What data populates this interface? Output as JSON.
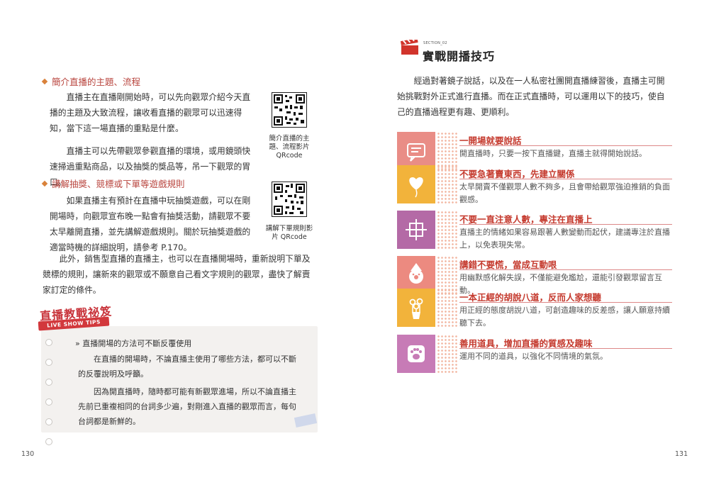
{
  "left": {
    "page_number": "130",
    "section1": {
      "heading": "簡介直播的主題、流程",
      "para1": "直播主在直播剛開始時，可以先向觀眾介紹今天直播的主題及大致流程，讓收看直播的觀眾可以迅速得知，當下這一場直播的重點是什麼。",
      "para2": "直播主可以先帶觀眾參觀直播的環境，或用鏡頭快速掃過重點商品，以及抽獎的獎品等，吊一下觀眾的胃口。",
      "qr_caption": "簡介直播的主題、流程影片 QRcode"
    },
    "section2": {
      "heading": "講解抽獎、競標或下單等遊戲規則",
      "para1": "如果直播主有預計在直播中玩抽獎遊戲，可以在剛開場時，向觀眾宣布晚一點會有抽獎活動，請觀眾不要太早離開直播，並先講解遊戲規則。關於玩抽獎遊戲的適當時機的詳細說明，請參考 P.170。",
      "qr_caption": "講解下單規則影片 QRcode",
      "para2": "此外，銷售型直播的直播主，也可以在直播開場時，重新說明下單及競標的規則，讓新來的觀眾或不願意自己看文字規則的觀眾，盡快了解賣家訂定的條件。"
    },
    "tips": {
      "badge_title": "直播教戰祕笈",
      "badge_sub": "LIVE SHOW TIPS",
      "label": "» 直播開場的方法可不斷反覆使用",
      "para1": "在直播的開場時，不論直播主使用了哪些方法，都可以不斷的反覆說明及呼籲。",
      "para2": "因為開直播時，隨時都可能有新觀眾進場，所以不論直播主先前已重複相同的台詞多少遍，對剛進入直播的觀眾而言，每句台詞都是新鮮的。"
    }
  },
  "right": {
    "page_number": "131",
    "section_tag": "SECTION_02",
    "title": "實戰開播技巧",
    "intro": "經過對著鏡子說話，以及在一人私密社團開直播練習後，直播主可開始挑戰對外正式進行直播。而在正式直播時，可以運用以下的技巧，使自己的直播過程更有趣、更順利。",
    "tips": [
      {
        "title": "一開場就要說話",
        "desc": "開直播時，只要一按下直播鍵，直播主就得開始說話。",
        "color": "#e98d86",
        "icon": "chat-bubble-icon"
      },
      {
        "title": "不要急著賣東西，先建立關係",
        "desc": "太早開賣不僅觀眾人數不夠多，且會帶給觀眾強迫推銷的負面觀感。",
        "color": "#f2b33b",
        "icon": "heart-balloon-icon"
      },
      {
        "title": "不要一直注意人數，專注在直播上",
        "desc": "直播主的情緒如果容易跟著人數變動而起伏，建議專注於直播上，以免表現失常。",
        "color": "#b46aa6",
        "icon": "crosshair-icon"
      },
      {
        "title": "講錯不要慌，當成互動哏",
        "desc": "用幽默感化解失誤，不僅能避免尷尬，還能引發觀眾留言互動。",
        "color": "#ec8a80",
        "icon": "clown-icon"
      },
      {
        "title": "一本正經的胡說八道，反而人家想聽",
        "desc": "用正經的態度胡說八道，可創造趣味的反差感，讓人願意持續聽下去。",
        "color": "#f2b33b",
        "icon": "flower-vase-icon"
      },
      {
        "title": "善用道具，增加直播的質感及趣味",
        "desc": "運用不同的道具，以強化不同情境的氣氛。",
        "color": "#c77bb6",
        "icon": "paw-icon"
      }
    ]
  }
}
